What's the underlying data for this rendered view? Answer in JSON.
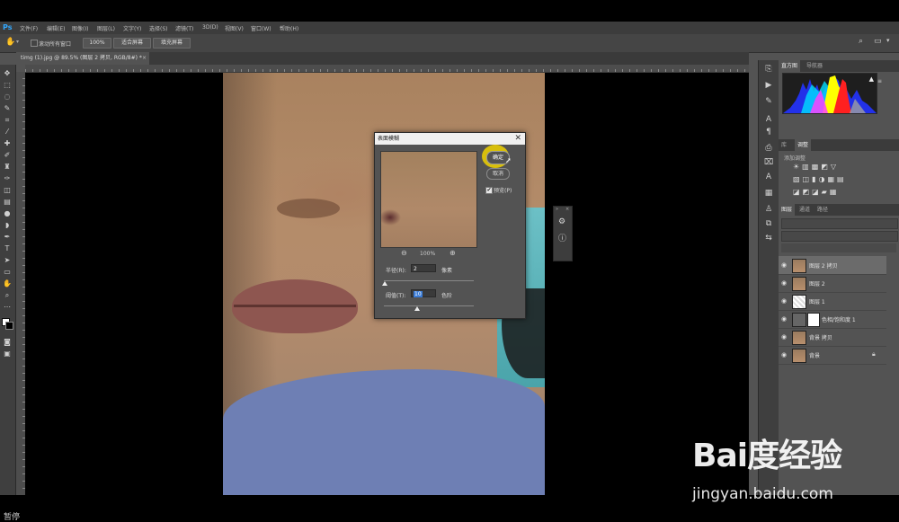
{
  "app": {
    "logo": "Ps"
  },
  "menubar": [
    "文件(F)",
    "编辑(E)",
    "图像(I)",
    "图层(L)",
    "文字(Y)",
    "选择(S)",
    "滤镜(T)",
    "3D(D)",
    "视图(V)",
    "窗口(W)",
    "帮助(H)"
  ],
  "options": {
    "scroll_all_label": "滚动所有窗口",
    "zoom": "100%",
    "fit_screen": "适合屏幕",
    "fill_screen": "填充屏幕"
  },
  "document": {
    "tab_title": "timg (1).jpg @ 89.5% (图层 2 拷贝, RGB/8#) *"
  },
  "dialog": {
    "title": "表面模糊",
    "ok_label": "确定",
    "cancel_label": "取消",
    "preview_label": "预览(P)",
    "preview_checked": "✔",
    "zoom": "100%",
    "radius_label": "半径(R):",
    "radius_value": "2",
    "radius_unit": "像素",
    "threshold_label": "阈值(T):",
    "threshold_value": "10",
    "threshold_unit": "色阶"
  },
  "panels": {
    "histogram_tabs": [
      "直方图",
      "导航器"
    ],
    "adjust_tabs": [
      "库",
      "调整"
    ],
    "adjust_title": "添加调整",
    "layers_tabs": [
      "图层",
      "通道",
      "路径"
    ],
    "layers": [
      {
        "name": "图层 2 拷贝",
        "selected": true
      },
      {
        "name": "图层 2"
      },
      {
        "name": "图层 1"
      },
      {
        "name": "色相/饱和度 1"
      },
      {
        "name": "背景 拷贝"
      },
      {
        "name": "背景"
      }
    ]
  },
  "watermark": {
    "logo": "Bai度经验",
    "url": "jingyan.baidu.com"
  },
  "status": {
    "pause": "暂停"
  }
}
